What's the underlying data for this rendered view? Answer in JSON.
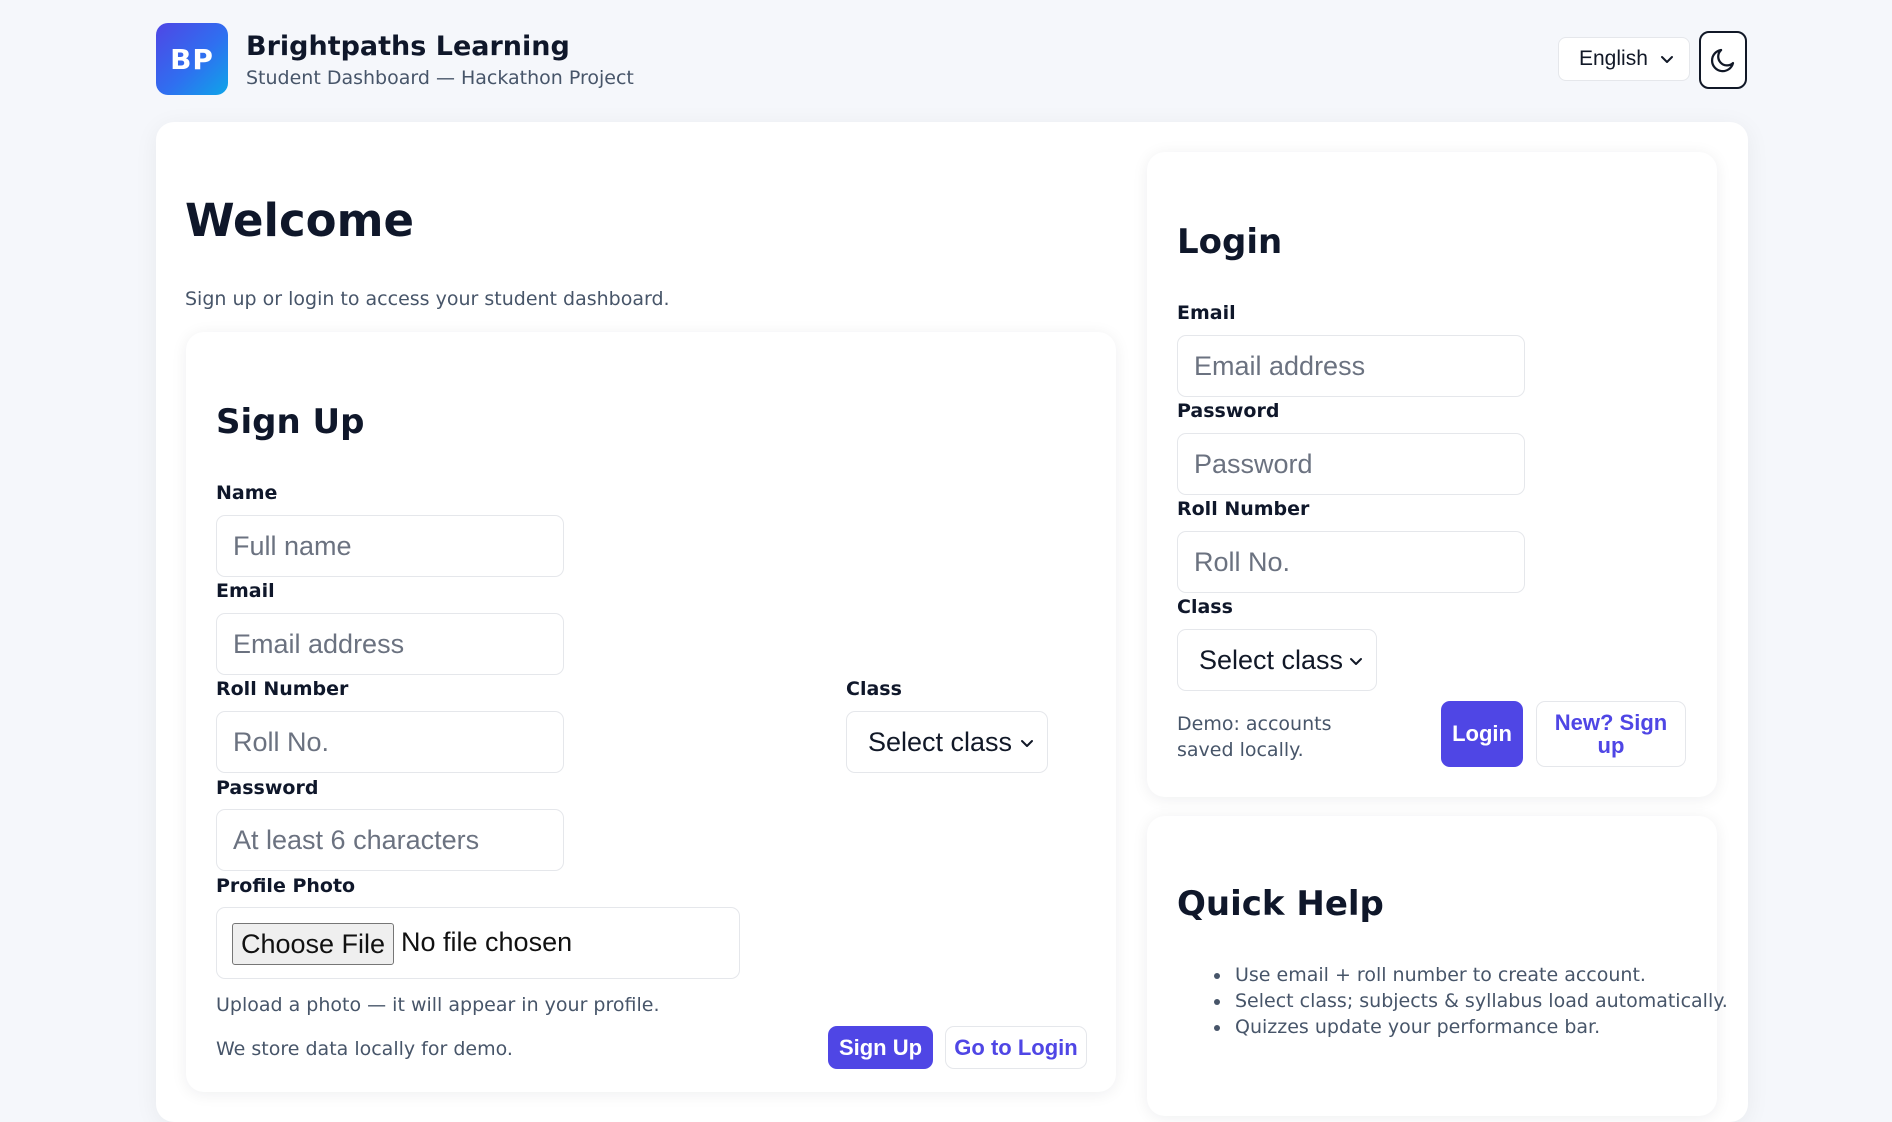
{
  "header": {
    "logo_text": "BP",
    "title": "Brightpaths Learning",
    "subtitle": "Student Dashboard — Hackathon Project",
    "language": "English",
    "theme_icon": "moon-icon"
  },
  "welcome": {
    "title": "Welcome",
    "subtitle": "Sign up or login to access your student dashboard."
  },
  "signup": {
    "title": "Sign Up",
    "name_label": "Name",
    "name_placeholder": "Full name",
    "email_label": "Email",
    "email_placeholder": "Email address",
    "roll_label": "Roll Number",
    "roll_placeholder": "Roll No.",
    "password_label": "Password",
    "password_placeholder": "At least 6 characters",
    "class_label": "Class",
    "class_value": "Select class",
    "photo_label": "Profile Photo",
    "file_button": "Choose File",
    "file_status": "No file chosen",
    "photo_hint": "Upload a photo — it will appear in your profile.",
    "storage_note": "We store data locally for demo.",
    "signup_button": "Sign Up",
    "goto_login_button": "Go to Login"
  },
  "login": {
    "title": "Login",
    "email_label": "Email",
    "email_placeholder": "Email address",
    "password_label": "Password",
    "password_placeholder": "Password",
    "roll_label": "Roll Number",
    "roll_placeholder": "Roll No.",
    "class_label": "Class",
    "class_value": "Select class",
    "demo_note": "Demo: accounts saved locally.",
    "login_button": "Login",
    "signup_link": "New? Sign up"
  },
  "help": {
    "title": "Quick Help",
    "items": [
      "Use email + roll number to create account.",
      "Select class; subjects & syllabus load automatically.",
      "Quizzes update your performance bar."
    ]
  },
  "colors": {
    "accent": "#4f46e5",
    "background": "#f5f7fb",
    "text": "#0f172a",
    "muted": "#475569"
  }
}
